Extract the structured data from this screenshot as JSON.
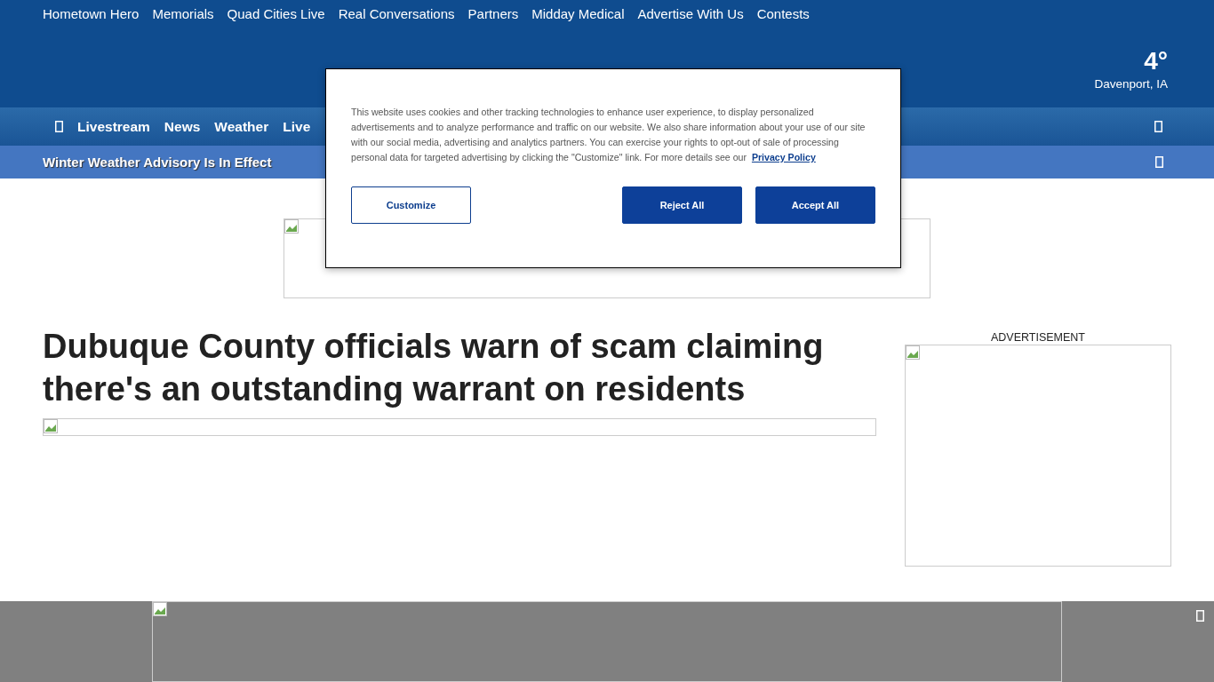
{
  "top_links": [
    "Hometown Hero",
    "Memorials",
    "Quad Cities Live",
    "Real Conversations",
    "Partners",
    "Midday Medical",
    "Advertise With Us",
    "Contests"
  ],
  "weather": {
    "temperature": "4°",
    "location": "Davenport, IA"
  },
  "main_nav": [
    "Livestream",
    "News",
    "Weather",
    "Live"
  ],
  "alert": {
    "text": "Winter Weather Advisory Is In Effect"
  },
  "article": {
    "headline": "Dubuque County officials warn of scam claiming there's an outstanding warrant on residents"
  },
  "sidebar": {
    "ad_label": "ADVERTISEMENT"
  },
  "cookie_dialog": {
    "text": "This website uses cookies and other tracking technologies to enhance user experience, to display personalized advertisements and to analyze performance and traffic on our website. We also share information about your use of our site with our social media, advertising and analytics partners. You can exercise your rights to opt-out of sale of processing personal data for targeted advertising by clicking the \"Customize\" link. For more details see our",
    "link": "Privacy Policy",
    "buttons": [
      {
        "label": "Customize",
        "kind": "outline"
      },
      {
        "label": "Reject All",
        "kind": "solid"
      },
      {
        "label": "Accept All",
        "kind": "solid"
      }
    ]
  }
}
